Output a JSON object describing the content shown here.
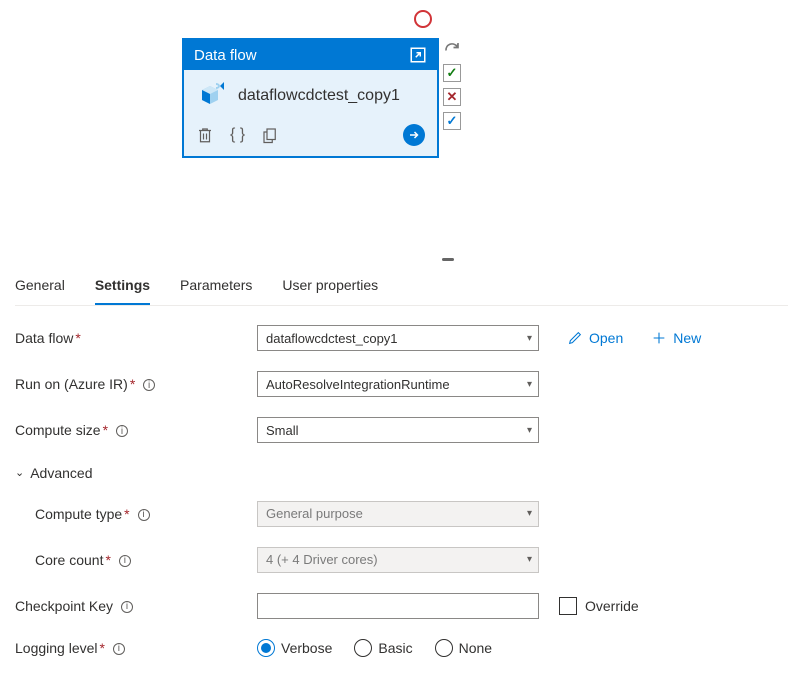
{
  "activity": {
    "header": "Data flow",
    "name": "dataflowcdctest_copy1",
    "icons": {
      "expand": "expand-icon",
      "delete": "trash-icon",
      "code": "braces-icon",
      "copy": "copy-page-icon",
      "proceed": "arrow-right-icon",
      "curved_arrow": "redo-curved-icon"
    }
  },
  "side_status": {
    "success": "✓",
    "failure": "✕",
    "pending": "✓"
  },
  "tabs": {
    "items": [
      "General",
      "Settings",
      "Parameters",
      "User properties"
    ],
    "active_index": 1
  },
  "form": {
    "dataflow": {
      "label": "Data flow",
      "value": "dataflowcdctest_copy1"
    },
    "open": {
      "label": "Open"
    },
    "new": {
      "label": "New"
    },
    "run_on": {
      "label": "Run on (Azure IR)",
      "value": "AutoResolveIntegrationRuntime"
    },
    "compute_size": {
      "label": "Compute size",
      "value": "Small"
    },
    "advanced_label": "Advanced",
    "compute_type": {
      "label": "Compute type",
      "value": "General purpose"
    },
    "core_count": {
      "label": "Core count",
      "value": "4 (+ 4 Driver cores)"
    },
    "checkpoint": {
      "label": "Checkpoint Key",
      "value": "",
      "override_label": "Override"
    },
    "logging": {
      "label": "Logging level",
      "options": [
        "Verbose",
        "Basic",
        "None"
      ],
      "selected_index": 0
    }
  }
}
